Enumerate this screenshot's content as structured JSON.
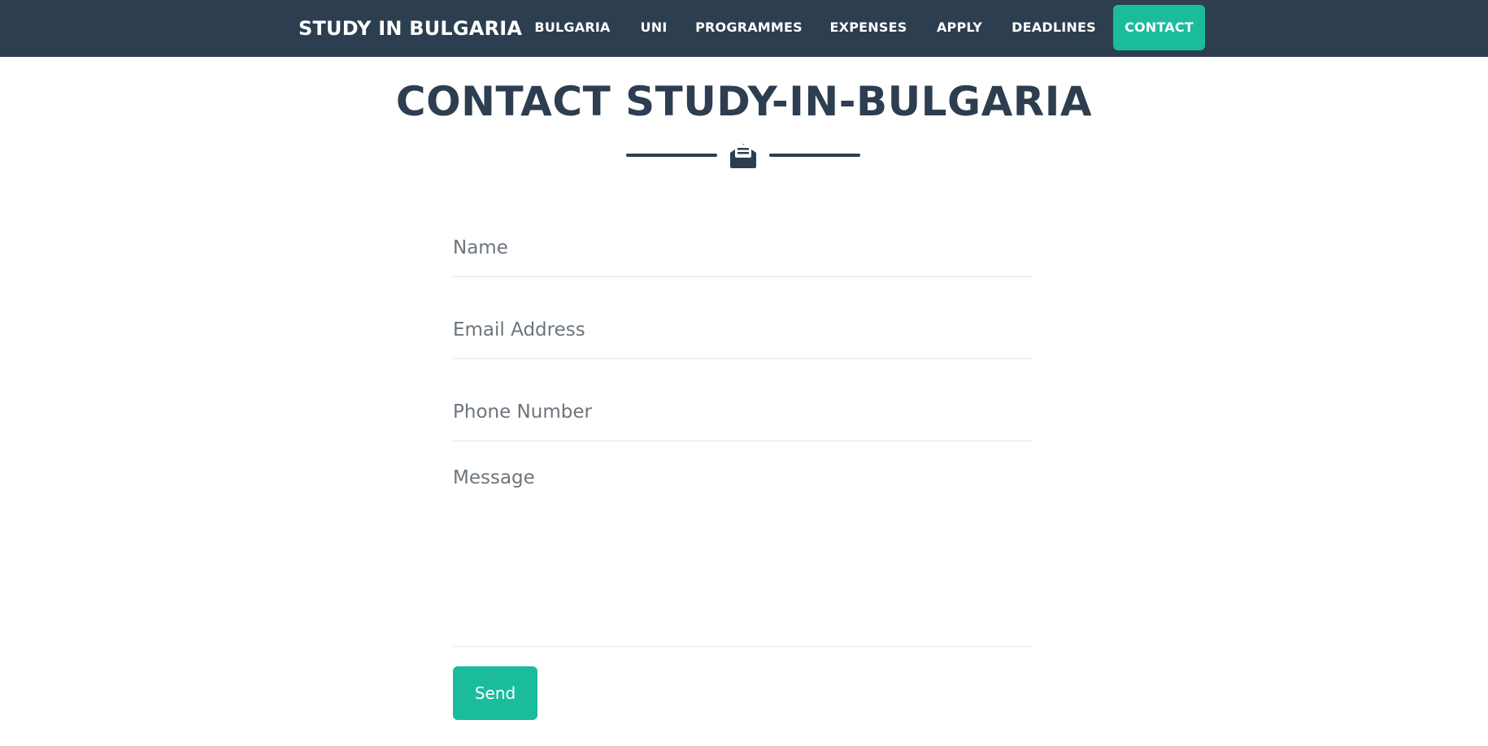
{
  "navbar": {
    "brand": "STUDY IN BULGARIA",
    "items": [
      {
        "label": "BULGARIA"
      },
      {
        "label": "UNI"
      },
      {
        "label": "PROGRAMMES"
      },
      {
        "label": "EXPENSES"
      },
      {
        "label": "APPLY"
      },
      {
        "label": "DEADLINES"
      },
      {
        "label": "CONTACT",
        "active": true
      }
    ]
  },
  "page": {
    "title": "CONTACT STUDY-IN-BULGARIA",
    "divider_icon": "envelope-open-text-icon"
  },
  "form": {
    "name_placeholder": "Name",
    "email_placeholder": "Email Address",
    "phone_placeholder": "Phone Number",
    "message_placeholder": "Message",
    "send_label": "Send"
  },
  "colors": {
    "navbar_bg": "#2c3e50",
    "accent": "#1abc9c",
    "text_dark": "#2c3e50",
    "placeholder": "#6c757d"
  }
}
